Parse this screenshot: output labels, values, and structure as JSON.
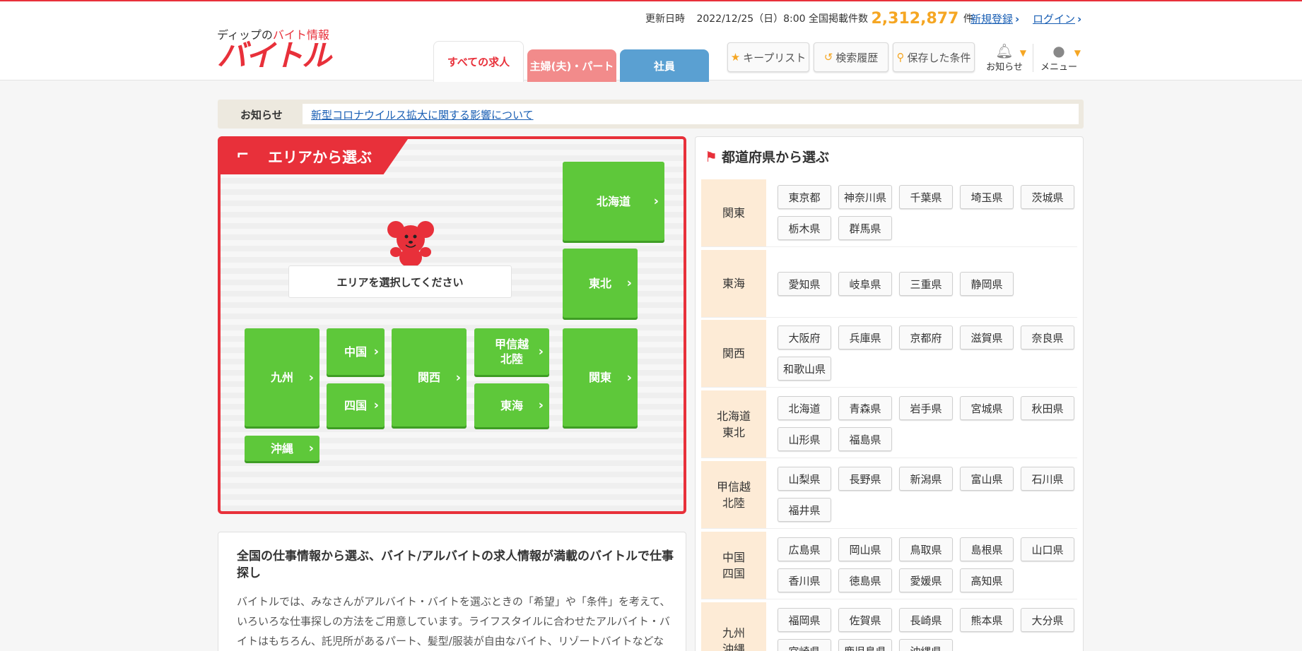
{
  "header": {
    "logo_sub_prefix": "ディップの",
    "logo_sub_accent": "バイト情報",
    "logo_main": "バイトル",
    "updated_label": "更新日時",
    "updated_value": "2022/12/25（日）8:00",
    "listings_label": "全国掲載件数",
    "listings_count": "2,312,877",
    "listings_unit": "件",
    "register": "新規登録",
    "login": "ログイン",
    "tabs": [
      {
        "label": "すべての求人",
        "color": "#ffffff"
      },
      {
        "label": "主婦(夫)・パート",
        "color": "#f28b8b"
      },
      {
        "label": "社員",
        "color": "#5aa0d2"
      }
    ],
    "tools": {
      "keep": "キープリスト",
      "history": "検索履歴",
      "saved": "保存した条件"
    },
    "notifications": "お知らせ",
    "menu": "メニュー"
  },
  "notice": {
    "label": "お知らせ",
    "link": "新型コロナウイルス拡大に関する影響について"
  },
  "area": {
    "title": "エリアから選ぶ",
    "prompt": "エリアを選択してください",
    "regions": {
      "hokkaido": "北海道",
      "tohoku": "東北",
      "kyushu": "九州",
      "chugoku": "中国",
      "shikoku": "四国",
      "kansai": "関西",
      "koshinetsu_1": "甲信越",
      "koshinetsu_2": "北陸",
      "tokai": "東海",
      "kanto": "関東",
      "okinawa": "沖縄"
    }
  },
  "description": {
    "heading": "全国の仕事情報から選ぶ、バイト/アルバイトの求人情報が満載のバイトルで仕事探し",
    "body": "バイトルでは、みなさんがアルバイト・バイトを選ぶときの「希望」や「条件」を考えて、いろいろな仕事探しの方法をご用意しています。ライフスタイルに合わせたアルバイト・バイトはもちろん、託児所があるパート、髪型/服装が自由なバイト、リゾートバイトなどな"
  },
  "prefectures": {
    "title": "都道府県から選ぶ",
    "rows": [
      {
        "region": "関東",
        "items": [
          "東京都",
          "神奈川県",
          "千葉県",
          "埼玉県",
          "茨城県",
          "栃木県",
          "群馬県"
        ]
      },
      {
        "region": "東海",
        "items": [
          "愛知県",
          "岐阜県",
          "三重県",
          "静岡県"
        ]
      },
      {
        "region": "関西",
        "items": [
          "大阪府",
          "兵庫県",
          "京都府",
          "滋賀県",
          "奈良県",
          "和歌山県"
        ]
      },
      {
        "region": "北海道\n東北",
        "items": [
          "北海道",
          "青森県",
          "岩手県",
          "宮城県",
          "秋田県",
          "山形県",
          "福島県"
        ]
      },
      {
        "region": "甲信越\n北陸",
        "items": [
          "山梨県",
          "長野県",
          "新潟県",
          "富山県",
          "石川県",
          "福井県"
        ]
      },
      {
        "region": "中国\n四国",
        "items": [
          "広島県",
          "岡山県",
          "鳥取県",
          "島根県",
          "山口県",
          "香川県",
          "徳島県",
          "愛媛県",
          "高知県"
        ]
      },
      {
        "region": "九州\n沖縄",
        "items": [
          "福岡県",
          "佐賀県",
          "長崎県",
          "熊本県",
          "大分県",
          "宮崎県",
          "鹿児島県",
          "沖縄県"
        ]
      }
    ]
  }
}
